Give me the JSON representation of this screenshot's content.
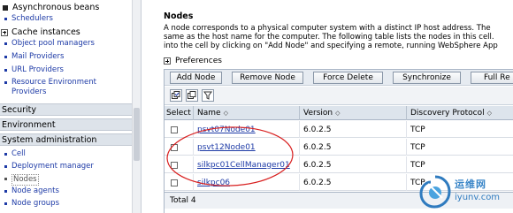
{
  "nav": {
    "top_items": [
      {
        "label": "Asynchronous beans",
        "marker": "square"
      },
      {
        "label": "Cache instances",
        "marker": "plus"
      }
    ],
    "links_a": [
      "Schedulers"
    ],
    "links_b": [
      "Object pool managers",
      "Mail Providers",
      "URL Providers",
      "Resource Environment Providers"
    ],
    "categories": [
      "Security",
      "Environment",
      "System administration"
    ],
    "sysadmin_links": [
      "Cell",
      "Deployment manager",
      "Nodes",
      "Node agents",
      "Node groups"
    ]
  },
  "page": {
    "title": "Nodes",
    "description_lines": [
      "A node corresponds to a physical computer system with a distinct IP host address. The",
      "same as the host name for the computer. The following table lists the nodes in this cell.",
      "into the cell by clicking on \"Add Node\" and specifying a remote, running WebSphere App"
    ],
    "preferences_label": "Preferences"
  },
  "toolbar": {
    "buttons": [
      "Add Node",
      "Remove Node",
      "Force Delete",
      "Synchronize",
      "Full Re"
    ],
    "icons": [
      "select-all-icon",
      "deselect-all-icon",
      "filter-icon"
    ]
  },
  "table": {
    "columns": [
      "Select",
      "Name",
      "Version",
      "Discovery Protocol"
    ],
    "sort_glyph": "◇",
    "rows": [
      {
        "name": "psvt07Node01",
        "version": "6.0.2.5",
        "protocol": "TCP"
      },
      {
        "name": "psvt12Node01",
        "version": "6.0.2.5",
        "protocol": "TCP"
      },
      {
        "name": "silkpc01CellManager01",
        "version": "6.0.2.5",
        "protocol": "TCP"
      },
      {
        "name": "silkpc06",
        "version": "6.0.2.5",
        "protocol": "TCP"
      }
    ],
    "total_label": "Total 4"
  },
  "watermark": {
    "cn": "运维网",
    "domain": "iyunv.com"
  },
  "colors": {
    "link": "#1d3aa6",
    "annotation": "#d81e1e",
    "category_bg": "#dde3ea"
  }
}
